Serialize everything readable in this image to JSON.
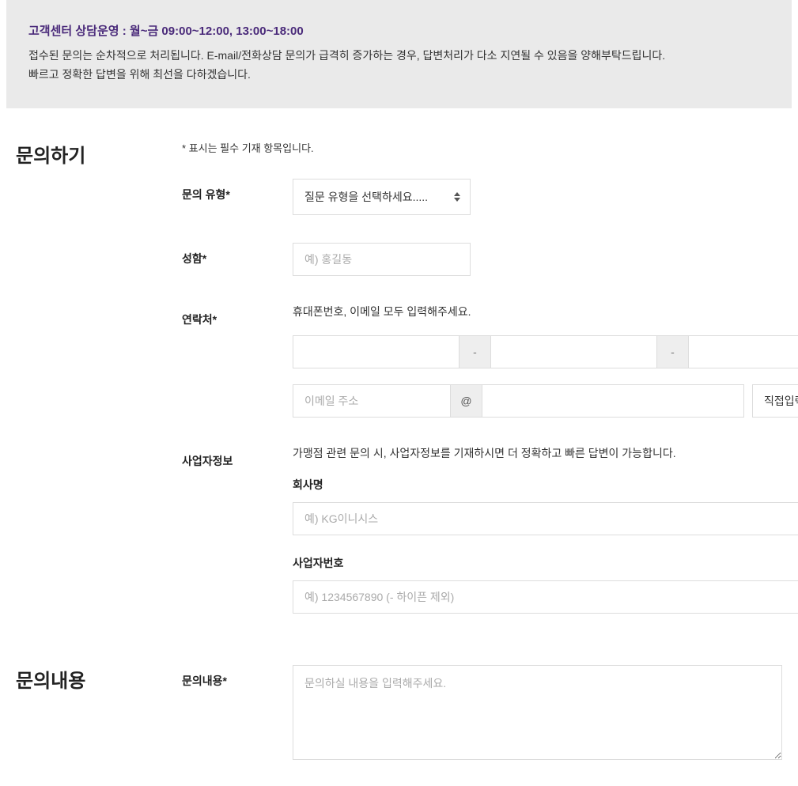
{
  "notice": {
    "title": "고객센터 상담운영 : 월~금 09:00~12:00, 13:00~18:00",
    "line1": "접수된 문의는 순차적으로 처리됩니다. E-mail/전화상담 문의가 급격히 증가하는 경우, 답변처리가 다소 지연될 수 있음을 양해부탁드립니다.",
    "line2": "빠르고 정확한 답변을 위해 최선을 다하겠습니다."
  },
  "inquiry": {
    "section_title": "문의하기",
    "required_note": "* 표시는 필수 기재 항목입니다.",
    "type_label": "문의 유형*",
    "type_placeholder": "질문 유형을 선택하세요.....",
    "name_label": "성함*",
    "name_placeholder": "예) 홍길동",
    "contact_label": "연락처*",
    "contact_hint": "휴대폰번호, 이메일 모두 입력해주세요.",
    "phone_sep": "-",
    "email_placeholder": "이메일 주소",
    "email_at": "@",
    "email_domain_option": "직접입력",
    "biz_label": "사업자정보",
    "biz_hint": "가맹점 관련 문의 시, 사업자정보를 기재하시면 더 정확하고 빠른 답변이 가능합니다.",
    "company_label": "회사명",
    "company_placeholder": "예) KG이니시스",
    "bizno_label": "사업자번호",
    "bizno_placeholder": "예) 1234567890 (- 하이픈 제외)"
  },
  "content": {
    "section_title": "문의내용",
    "label": "문의내용*",
    "placeholder": "문의하실 내용을 입력해주세요."
  }
}
